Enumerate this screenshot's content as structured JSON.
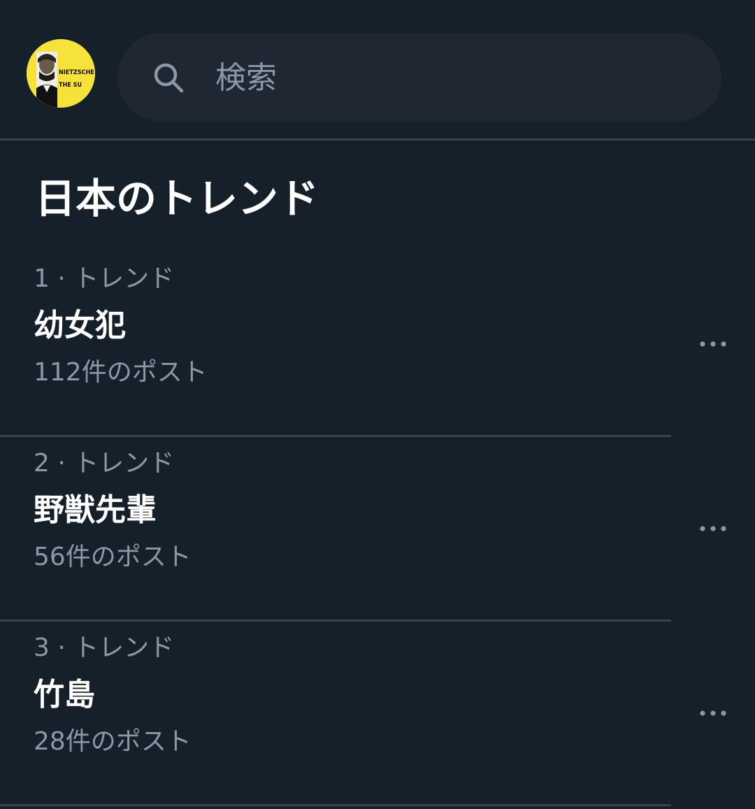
{
  "header": {
    "avatar_caption": "NIETZSCHE ON: THE SU",
    "search_placeholder": "検索",
    "search_value": ""
  },
  "section": {
    "title": "日本のトレンド"
  },
  "trends": [
    {
      "meta": "1 · トレンド",
      "name": "幼女犯",
      "count": "112件のポスト"
    },
    {
      "meta": "2 · トレンド",
      "name": "野獣先輩",
      "count": "56件のポスト"
    },
    {
      "meta": "3 · トレンド",
      "name": "竹島",
      "count": "28件のポスト"
    }
  ],
  "icons": {
    "search": "search-icon",
    "more": "more-horizontal-icon"
  },
  "colors": {
    "background": "#15202b",
    "search_background": "#1e2732",
    "divider": "#38444d",
    "secondary_text": "#8b98a5",
    "primary_text": "#ffffff",
    "avatar_yellow": "#f7e23a"
  }
}
